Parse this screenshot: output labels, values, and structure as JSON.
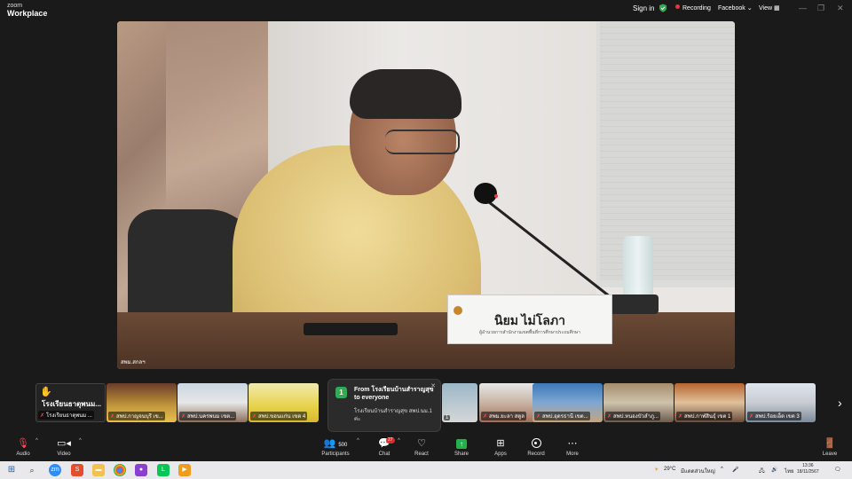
{
  "app": {
    "brand_line1": "zoom",
    "brand_line2": "Workplace"
  },
  "topbar": {
    "signin": "Sign in",
    "recording": "Recording",
    "facebook": "Facebook",
    "view": "View"
  },
  "video": {
    "nameplate_name": "นิยม ไม่โลภา",
    "nameplate_sub": "ผู้อำนวยการสำนักงานเขตพื้นที่การศึกษาประถมศึกษา",
    "watermark": "สพม.สกลฯ"
  },
  "strip": {
    "raised_hand_name": "โรงเรียนธาตุพนม...",
    "raised_hand_sub": "โรงเรียนธาตุพนม ...",
    "tiles": [
      {
        "label": "สพป.กาญจนบุรี เข..."
      },
      {
        "label": "สพป.นครพนม เขต..."
      },
      {
        "label": "สพป.ขอนแก่น เขต 4"
      },
      {
        "label": "1"
      },
      {
        "label": "สพม.ยะลา สตูล"
      },
      {
        "label": "สพป.อุดรธานี เขต..."
      },
      {
        "label": "สพป.หนองบัวลำภู..."
      },
      {
        "label": "สพป.กาฬสินธุ์ เขต 1"
      },
      {
        "label": "สพป.ร้อยเอ็ด เขต 3"
      }
    ]
  },
  "popup": {
    "badge": "1",
    "title": "From โรงเรียนบ้านสำราญสุข to everyone",
    "message": "โรงเรียนบ้านสำราญสุข สพป.นม.1 ค่ะ",
    "close": "✕"
  },
  "toolbar": {
    "audio": "Audio",
    "video": "Video",
    "participants": "Participants",
    "participants_count": "500",
    "chat": "Chat",
    "chat_badge": "27",
    "react": "React",
    "share": "Share",
    "apps": "Apps",
    "record": "Record",
    "more": "More",
    "leave": "Leave"
  },
  "taskbar": {
    "weather": "29°C",
    "weather_desc": "มีแดดส่วนใหญ่",
    "lang": "ไทย",
    "time": "13:36",
    "date": "18/11/2567"
  }
}
